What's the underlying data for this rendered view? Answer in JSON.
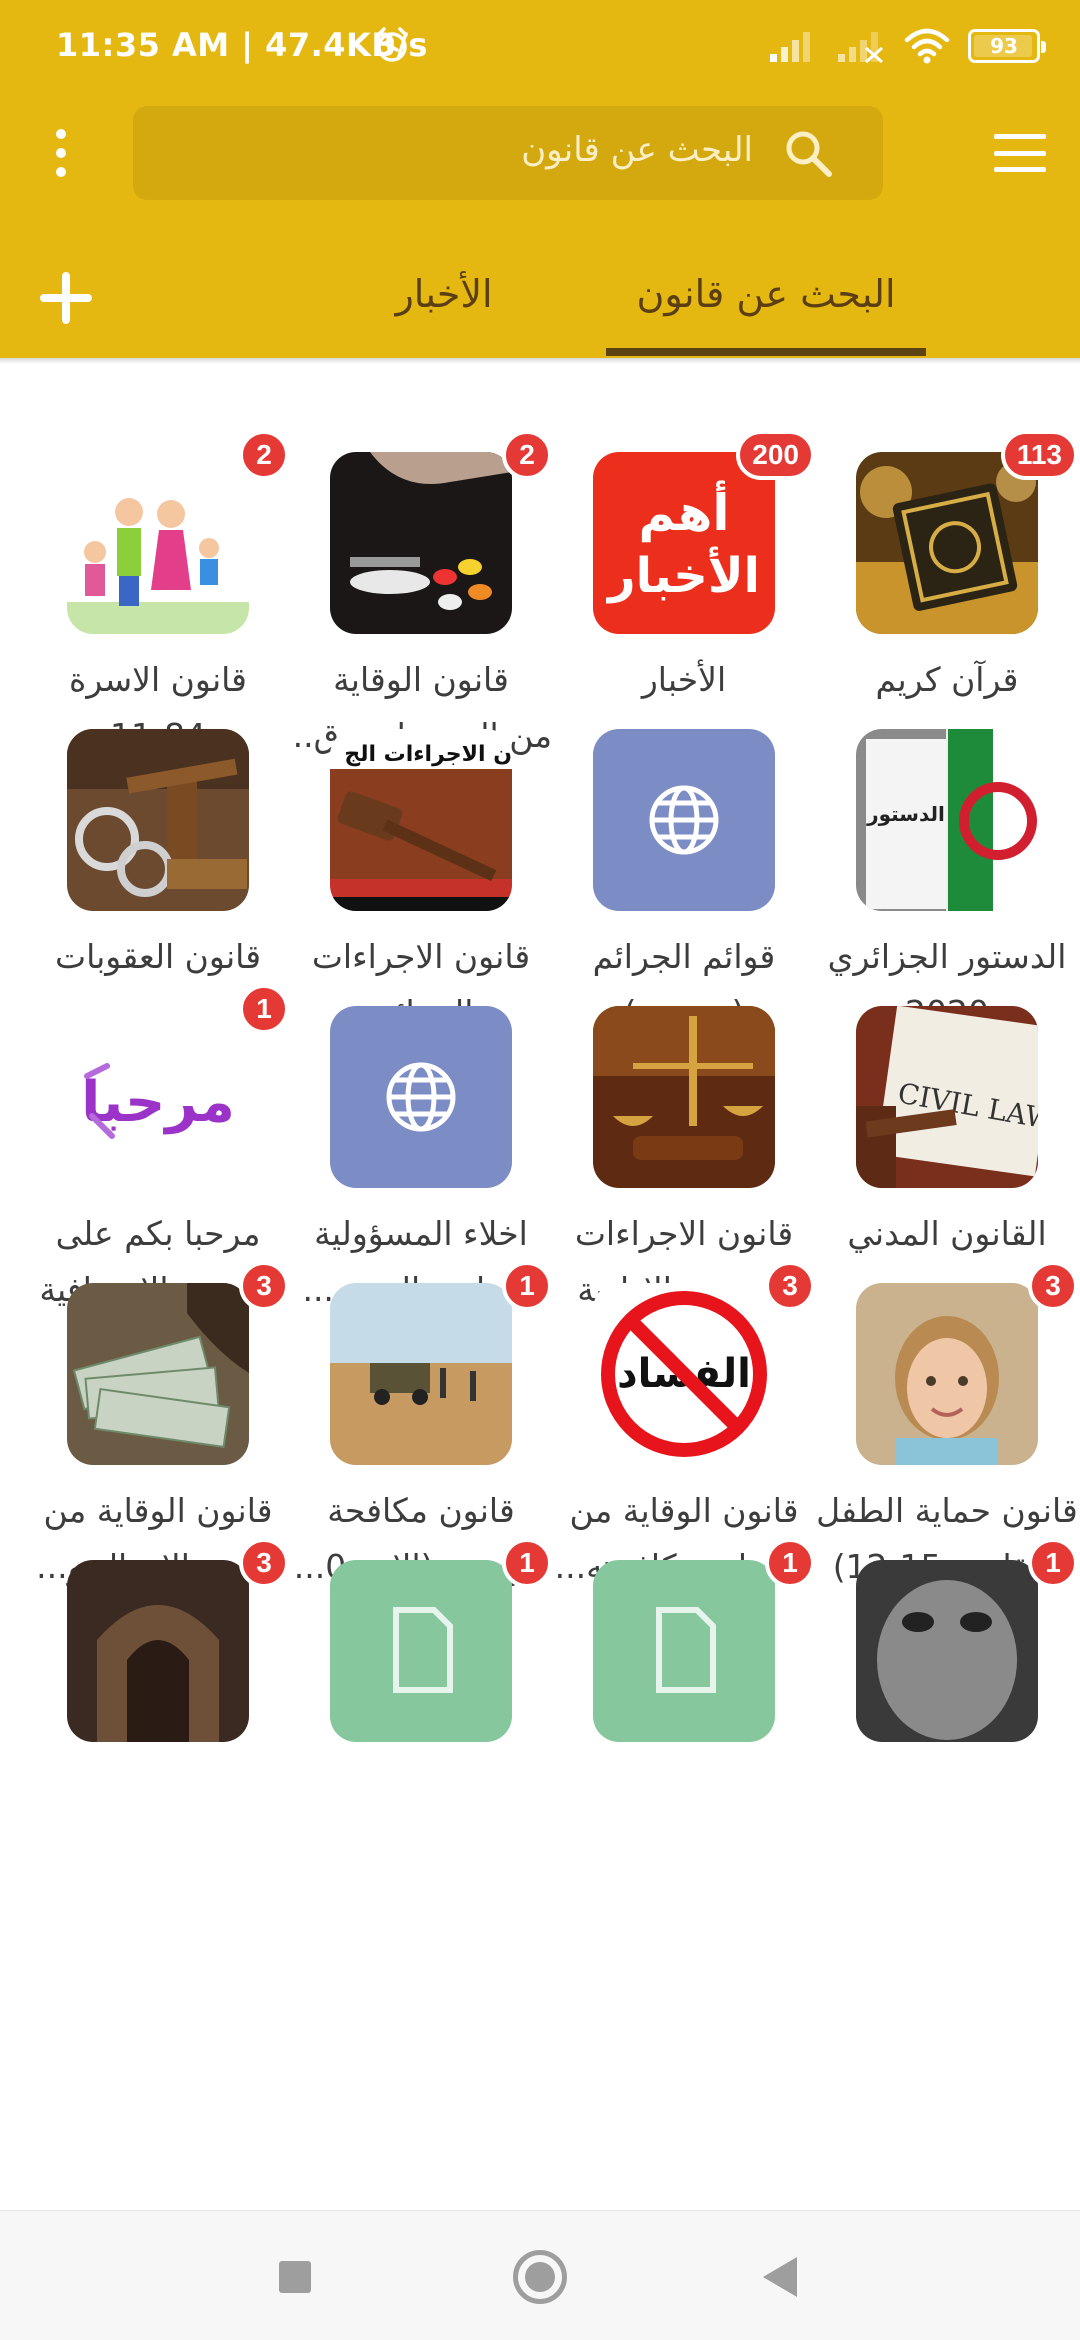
{
  "status_bar": {
    "time": "11:35 AM | 47.4KB/s",
    "battery": "93"
  },
  "search": {
    "placeholder": "البحث عن قانون"
  },
  "tabs": {
    "search": "البحث عن قانون",
    "news": "الأخبار",
    "selected": "search"
  },
  "colors": {
    "app_bar": "#e5b811",
    "badge": "#e53935",
    "web_tile": "#7c8cc4",
    "file_tile": "#86c79e"
  },
  "grid": {
    "items": [
      {
        "line1": "قرآن كريم",
        "line2": "",
        "badge": "113",
        "icon": "quran-icon"
      },
      {
        "line1": "الأخبار",
        "line2": "",
        "badge": "200",
        "icon": "news-logo-icon",
        "icon_text_1": "أهم",
        "icon_text_2": "الأخبار"
      },
      {
        "line1": "قانون الوقاية",
        "line2": "من المخدرات وق...",
        "badge": "2",
        "icon": "drugs-icon"
      },
      {
        "line1": "قانون الاسرة",
        "line2": "11-84",
        "badge": "2",
        "icon": "family-icon"
      },
      {
        "line1": "الدستور الجزائري",
        "line2": "2020",
        "badge": "",
        "icon": "constitution-icon",
        "icon_text_1": "الدستور"
      },
      {
        "line1": "قوائم الجرائم",
        "line2": "(تجريبي)",
        "badge": "",
        "icon": "globe-icon"
      },
      {
        "line1": "قانون الاجراءات",
        "line2": "الجزائية",
        "badge": "",
        "icon": "gavel-book-icon",
        "icon_text_1": "ن الاجراءات الج"
      },
      {
        "line1": "قانون العقوبات",
        "line2": "",
        "badge": "",
        "icon": "handcuffs-gavel-icon"
      },
      {
        "line1": "القانون المدني",
        "line2": "",
        "badge": "",
        "icon": "civil-law-icon",
        "icon_text_1": "CIVIL LAW"
      },
      {
        "line1": "قانون الاجراءات",
        "line2": "المدنية والادارية",
        "badge": "",
        "icon": "scales-gavel-icon"
      },
      {
        "line1": "اخلاء المسؤولية",
        "line2": "وسياسة الخصو...",
        "badge": "",
        "icon": "globe-icon"
      },
      {
        "line1": "مرحبا بكم على",
        "line2": "النسخة الاحترافية",
        "badge": "1",
        "icon": "welcome-icon",
        "icon_text_1": "مرحبا"
      },
      {
        "line1": "قانون حماية الطفل",
        "line2": "(القانون 15-12)",
        "badge": "3",
        "icon": "child-icon"
      },
      {
        "line1": "قانون الوقاية من",
        "line2": "الفساد ومكافحته...",
        "badge": "3",
        "icon": "no-corruption-icon",
        "icon_text_1": "الفساد"
      },
      {
        "line1": "قانون مكافحة",
        "line2": "التهريب (الامر 0...",
        "badge": "1",
        "icon": "desert-vehicle-icon"
      },
      {
        "line1": "قانون الوقاية من",
        "line2": "تبييض الاموال و...",
        "badge": "3",
        "icon": "money-icon"
      },
      {
        "line1": "",
        "line2": "",
        "badge": "1",
        "icon": "face-icon"
      },
      {
        "line1": "",
        "line2": "",
        "badge": "1",
        "icon": "file-icon"
      },
      {
        "line1": "",
        "line2": "",
        "badge": "1",
        "icon": "file-icon"
      },
      {
        "line1": "",
        "line2": "",
        "badge": "3",
        "icon": "mosque-icon"
      }
    ]
  }
}
